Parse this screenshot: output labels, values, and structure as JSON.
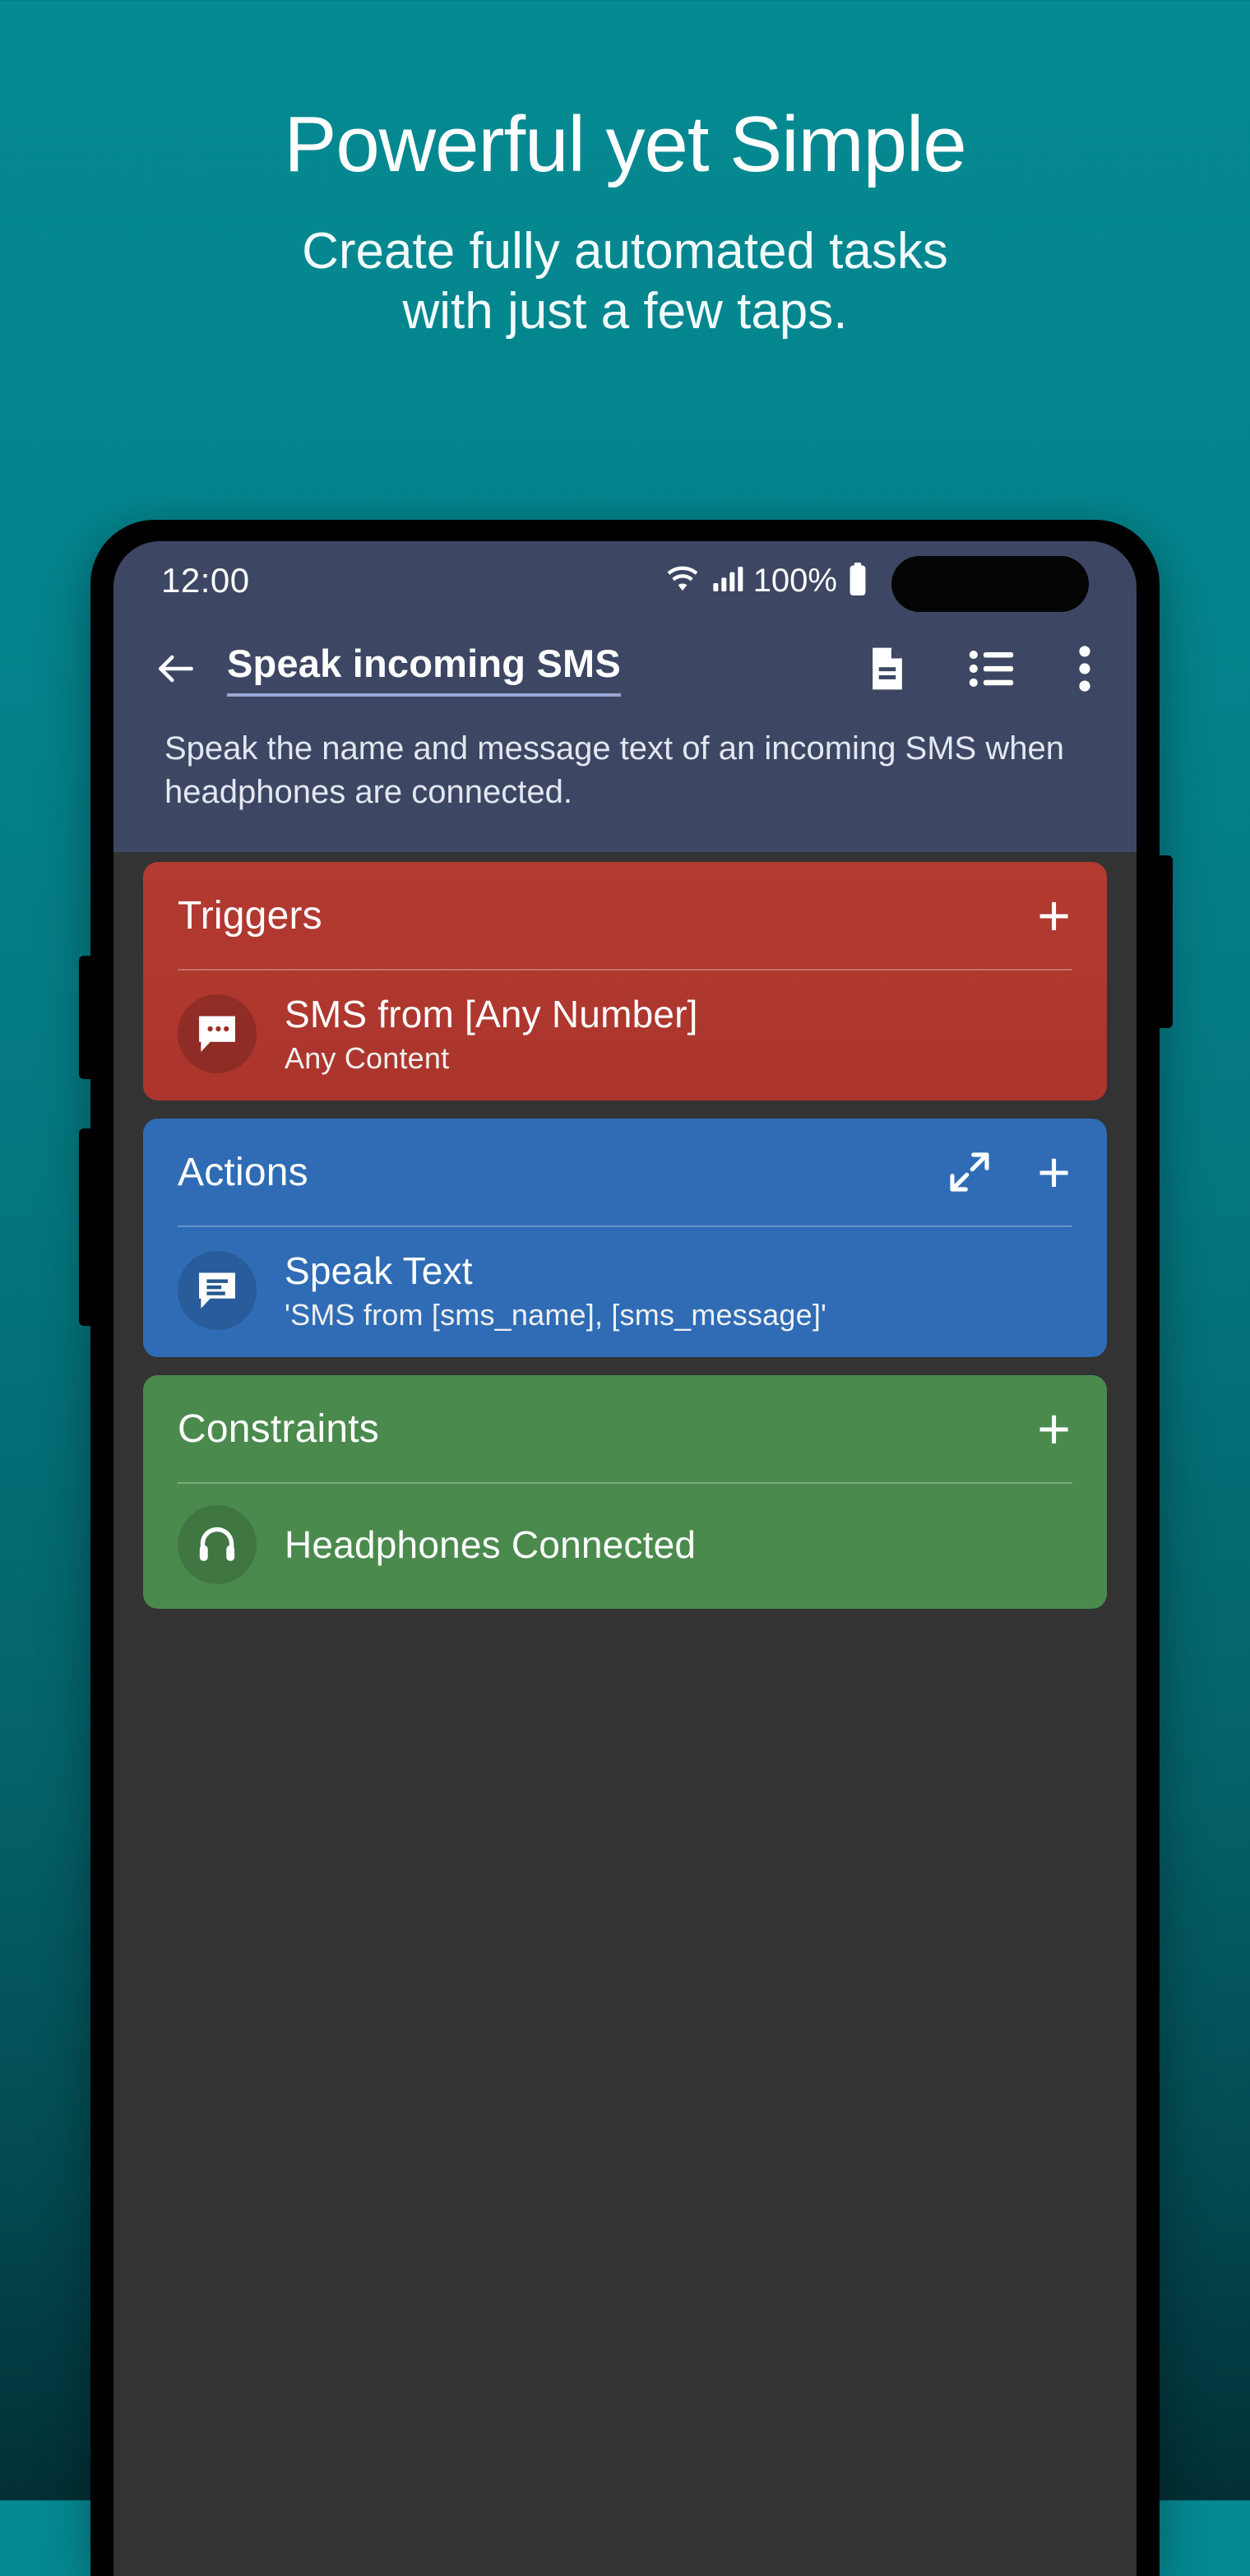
{
  "promo": {
    "title": "Powerful yet Simple",
    "subtitle_line1": "Create fully automated tasks",
    "subtitle_line2": "with just a few taps."
  },
  "phone": {
    "status_bar": {
      "time": "12:00",
      "battery_percent": "100%",
      "wifi_icon": "wifi-icon",
      "signal_icon": "cellular-signal-icon",
      "battery_icon": "battery-full-icon"
    },
    "toolbar": {
      "back_icon": "back-arrow-icon",
      "title": "Speak incoming SMS",
      "actions": [
        {
          "name": "description-icon",
          "label": "Description"
        },
        {
          "name": "list-icon",
          "label": "List"
        },
        {
          "name": "overflow-menu-icon",
          "label": "More options"
        }
      ]
    },
    "task_description": "Speak the name and message text of an incoming SMS when headphones are connected.",
    "sections": [
      {
        "id": "triggers",
        "title": "Triggers",
        "color": "#b23a31",
        "add_label": "+",
        "expand": false,
        "items": [
          {
            "icon": "sms-message-icon",
            "title": "SMS from [Any Number]",
            "subtitle": "Any Content"
          }
        ]
      },
      {
        "id": "actions",
        "title": "Actions",
        "color": "#2f6cb5",
        "add_label": "+",
        "expand": true,
        "expand_icon": "expand-diagonal-icon",
        "items": [
          {
            "icon": "speak-text-icon",
            "title": "Speak Text",
            "subtitle": "'SMS from [sms_name], [sms_message]'"
          }
        ]
      },
      {
        "id": "constraints",
        "title": "Constraints",
        "color": "#4a8a4d",
        "add_label": "+",
        "expand": false,
        "items": [
          {
            "icon": "headphones-icon",
            "title": "Headphones Connected",
            "subtitle": ""
          }
        ]
      }
    ]
  },
  "colors": {
    "background_top": "#058a92",
    "background_bottom": "#022f35",
    "appbar": "#3d4763",
    "screen_body": "#333333",
    "trigger": "#b23a31",
    "action": "#2f6cb5",
    "constraint": "#4a8a4d",
    "title_underline": "#9aa6d4"
  }
}
